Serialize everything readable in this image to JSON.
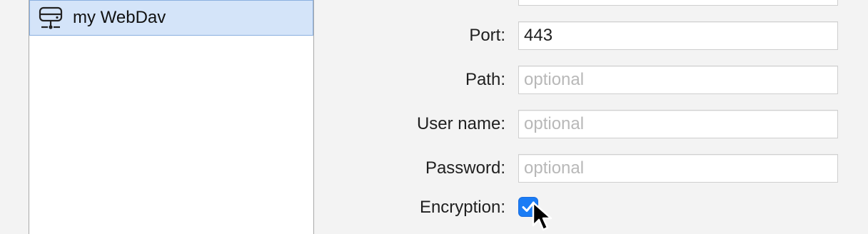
{
  "list": {
    "items": [
      {
        "label": "my WebDav",
        "icon": "network-drive-icon",
        "selected": true
      }
    ]
  },
  "form": {
    "port": {
      "label": "Port:",
      "value": "443",
      "placeholder": ""
    },
    "path": {
      "label": "Path:",
      "value": "",
      "placeholder": "optional"
    },
    "username": {
      "label": "User name:",
      "value": "",
      "placeholder": "optional"
    },
    "password": {
      "label": "Password:",
      "value": "",
      "placeholder": "optional"
    },
    "encryption": {
      "label": "Encryption:",
      "checked": true
    }
  },
  "colors": {
    "accent": "#1a7cf5",
    "selection": "#d4e4f9",
    "background": "#f3f3f3"
  }
}
